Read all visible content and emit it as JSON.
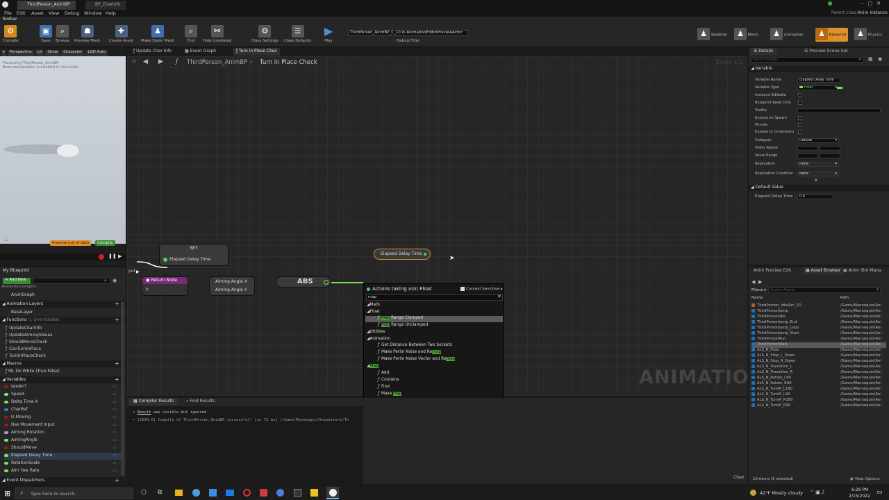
{
  "window": {
    "tabs": [
      "ThirdPerson_AnimBP",
      "BP_CharInfo"
    ],
    "parent_class_label": "Parent class:",
    "parent_class_value": "Anim Instance"
  },
  "menu": [
    "File",
    "Edit",
    "Asset",
    "View",
    "Debug",
    "Window",
    "Help"
  ],
  "toolbar_tab": "Toolbar",
  "toolbar": {
    "compile": "Compile",
    "save": "Save",
    "browse": "Browse",
    "preview_mesh": "Preview Mesh",
    "create_asset": "Create Asset",
    "make_static_mesh": "Make Static Mesh",
    "find": "Find",
    "hide_unrelated": "Hide Unrelated",
    "class_settings": "Class Settings",
    "class_defaults": "Class Defaults",
    "play": "Play",
    "debug_object": "ThirdPerson_AnimBP_C_10 in AnimationEditorPreviewActor",
    "debug_filter": "Debug Filter"
  },
  "modes": [
    "Skeleton",
    "Mesh",
    "Animation",
    "Blueprint",
    "Physics"
  ],
  "viewport": {
    "buttons": [
      "Perspective",
      "Lit",
      "Show",
      "Character",
      "LOD Auto"
    ],
    "notice_line1": "Previewing ThirdPerson_AnimBP.",
    "notice_line2": "Bone manipulation is disabled in this mode.",
    "preview_out_of_date": "Preview out of date",
    "compile_btn": "Compile"
  },
  "graph_tabs": [
    "Update Char Info",
    "Event Graph",
    "Turn in Place Chec"
  ],
  "breadcrumb": {
    "root": "ThirdPerson_AnimBP",
    "sep": "›",
    "current": "Turn in Place Check"
  },
  "zoom": "Zoom 1:1",
  "watermark": "ANIMATION",
  "nodes": {
    "set_title": "SET",
    "set_pin": "Elapsed Delay Time",
    "getter": "Elapsed Delay Time",
    "return_node": "Return Node",
    "aiming_x": "Aiming Angle X",
    "aiming_y": "Aiming Angle Y",
    "abs": "ABS",
    "cut_label": "put"
  },
  "action_menu": {
    "title": "Actions taking a(n) Float",
    "context_sensitive": "Context Sensitive",
    "search_value": "map",
    "items": [
      {
        "kind": "cat",
        "label": "Math"
      },
      {
        "kind": "cat",
        "label": "Float"
      },
      {
        "kind": "fn",
        "pre": "",
        "hl": "Map",
        "post": " Range Clamped",
        "selected": true
      },
      {
        "kind": "fn",
        "pre": "",
        "hl": "Map",
        "post": " Range Unclamped"
      },
      {
        "kind": "cat",
        "label": "Utilities"
      },
      {
        "kind": "cat",
        "label": "Animation"
      },
      {
        "kind": "fn",
        "pre": "Get Distance Between Two Sockets",
        "hl": "",
        "post": ""
      },
      {
        "kind": "fn",
        "pre": "Make Perlin Noise and Re",
        "hl": "map",
        "post": ""
      },
      {
        "kind": "fn",
        "pre": "Make Perlin Noise Vector and Re",
        "hl": "map",
        "post": ""
      },
      {
        "kind": "cat",
        "label": "Map",
        "hlcat": true
      },
      {
        "kind": "fn",
        "pre": "Add",
        "hl": "",
        "post": ""
      },
      {
        "kind": "fn",
        "pre": "Contains",
        "hl": "",
        "post": ""
      },
      {
        "kind": "fn",
        "pre": "Find",
        "hl": "",
        "post": ""
      },
      {
        "kind": "fn",
        "pre": "Make ",
        "hl": "Map",
        "post": ""
      },
      {
        "kind": "fn",
        "pre": "Remove",
        "hl": "",
        "post": ""
      },
      {
        "kind": "cat",
        "label": "Struct"
      },
      {
        "kind": "fn",
        "pre": "Make InputAxisKey",
        "hl": "Map",
        "post": "ping"
      }
    ]
  },
  "my_blueprint": {
    "tab": "My Blueprint",
    "add_new": "Add New",
    "animation_graphs": "Animation Graphs",
    "anim_graph": "AnimGraph",
    "animation_layers": "Animation Layers",
    "base_layer": "BaseLayer",
    "functions": "Functions",
    "functions_count": "(1 Overridable)",
    "function_items": [
      "UpdateCharInfo",
      "UpdateAimingValues",
      "ShouldMoveCheck",
      "CanTurnInPlace",
      "TurnInPlaceCheck"
    ],
    "macros": "Macros",
    "macro_items": [
      "ML Do While (True False)"
    ],
    "variables": "Variables",
    "variable_items": [
      "IsInAir?",
      "Speed",
      "Delta Time X",
      "CharRef",
      "Is Moving",
      "Has Movement Input",
      "Aiming Rotation",
      "AimingAngle",
      "ShouldMove",
      "Elapsed Delay Time",
      "RotationScale",
      "Aim Yaw Rate"
    ],
    "variable_colors": [
      "#a01818",
      "#7ce35a",
      "#7ce35a",
      "#2b7fd0",
      "#a01818",
      "#a01818",
      "#b58cf0",
      "#7ce35a",
      "#a01818",
      "#7ce35a",
      "#7ce35a",
      "#7ce35a"
    ],
    "event_dispatchers": "Event Dispatchers"
  },
  "compiler": {
    "tabs": [
      "Compiler Results",
      "Find Results"
    ],
    "line1_link": "Result",
    "line1_rest": " was visible but ignored",
    "line2": "[2634.0] Compile of ThirdPerson_AnimBP successful! [in 72 ms] (/Game/Mannequin/Animations/Th",
    "clear": "Clear"
  },
  "details": {
    "tabs": [
      "Details",
      "Preview Scene Set"
    ],
    "search_placeholder": "Search Details",
    "variable_header": "Variable",
    "rows": [
      {
        "label": "Variable Name",
        "value": "Elapsed Delay Time",
        "type": "text"
      },
      {
        "label": "Variable Type",
        "value": "Float",
        "type": "type"
      },
      {
        "label": "Instance Editable",
        "type": "check"
      },
      {
        "label": "Blueprint Read Only",
        "type": "check"
      },
      {
        "label": "Tooltip",
        "value": "",
        "type": "wide"
      },
      {
        "label": "Expose on Spawn",
        "type": "check"
      },
      {
        "label": "Private",
        "type": "check"
      },
      {
        "label": "Expose to Cinematics",
        "type": "check"
      },
      {
        "label": "Category",
        "value": "Default",
        "type": "combo"
      },
      {
        "label": "Slider Range",
        "type": "range"
      },
      {
        "label": "Value Range",
        "type": "range"
      },
      {
        "label": "Replication",
        "value": "None",
        "type": "combo"
      },
      {
        "label": "Replication Condition",
        "value": "None",
        "type": "combo"
      }
    ],
    "default_value_header": "Default Value",
    "default_label": "Elapsed Delay Time",
    "default_value": "0.0"
  },
  "asset_browser": {
    "tabs": [
      "Anim Preview Edit",
      "Asset Browser",
      "Anim Slot Mana"
    ],
    "filters": "Filters",
    "search_placeholder": "Search Assets",
    "col_name": "Name",
    "col_path": "Path",
    "rows": [
      "ThirdPerson_IdleRun_2D",
      "ThirdPersonJump",
      "ThirdPersonIdle",
      "ThirdPersonJump_End",
      "ThirdPersonJump_Loop",
      "ThirdPersonJump_Start",
      "ThirdPersonRun",
      "ThirdPersonWalk",
      "ALS_N_Pose",
      "ALS_N_Stop_L_Down",
      "ALS_N_Stop_R_Down",
      "ALS_N_Transition_L",
      "ALS_N_Transition_R",
      "ALS_N_Rotate_L90",
      "ALS_N_Rotate_R90",
      "ALS_N_TurnIP_L180",
      "ALS_N_TurnIP_L90",
      "ALS_N_TurnIP_R180",
      "ALS_N_TurnIP_R90"
    ],
    "path": "/Game/Mannequin/Ani",
    "status": "19 items (1 selected)",
    "view_options": "View Options"
  },
  "taskbar": {
    "search_placeholder": "Type here to search",
    "weather": "42°F  Mostly cloudy",
    "time": "6:28 PM",
    "date": "2/15/2022"
  },
  "colors": {
    "accent_orange": "#e0902a",
    "float_green": "#7ce35a",
    "return_purple": "#7a2a7a",
    "selection_blue": "#2f6fc0"
  }
}
